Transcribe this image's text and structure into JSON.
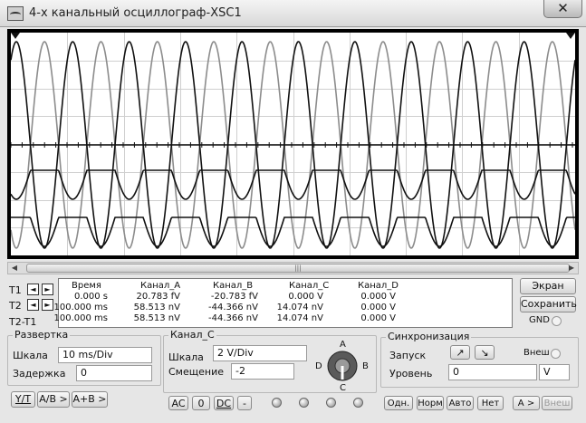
{
  "window": {
    "title": "4-х канальный осциллограф-XSC1",
    "close": "✕"
  },
  "colors": {
    "black_trace": "#111111",
    "gray_trace": "#8c8c8c"
  },
  "scroll": {
    "left_arrow": "◀",
    "right_arrow": "▶",
    "grip": "|||"
  },
  "readout": {
    "row_labels": [
      "T1",
      "T2",
      "T2-T1"
    ],
    "arrow_left": "◄",
    "arrow_right": "►",
    "columns": [
      "Время",
      "Канал_A",
      "Канал_B",
      "Канал_C",
      "Канал_D"
    ],
    "rows": [
      [
        "0.000 s",
        "20.783 fV",
        "-20.783 fV",
        "0.000 V",
        "0.000 V"
      ],
      [
        "100.000 ms",
        "58.513 nV",
        "-44.366 nV",
        "14.074 nV",
        "0.000 V"
      ],
      [
        "100.000 ms",
        "58.513 nV",
        "-44.366 nV",
        "14.074 nV",
        "0.000 V"
      ]
    ]
  },
  "side": {
    "screen_btn": "Экран",
    "save_btn": "Сохранить",
    "gnd": "GND"
  },
  "timebase": {
    "title": "Развертка",
    "scale_label": "Шкала",
    "scale_value": "10 ms/Div",
    "delay_label": "Задержка",
    "delay_value": "0",
    "yt": "Y/T",
    "ab": "A/B >",
    "apb": "A+B >"
  },
  "channel": {
    "title": "Канал_C",
    "scale_label": "Шкала",
    "scale_value": "2  V/Div",
    "offset_label": "Смещение",
    "offset_value": "-2",
    "ac": "AC",
    "zero": "0",
    "dc": "DC",
    "minus": "-",
    "knob": {
      "a": "A",
      "b": "B",
      "c": "C",
      "d": "D"
    }
  },
  "trigger": {
    "title": "Синхронизация",
    "start_label": "Запуск",
    "rise": "↗",
    "fall": "↘",
    "ext": "Внеш",
    "level_label": "Уровень",
    "level_value": "0",
    "level_unit": "V",
    "single": "Одн.",
    "normal": "Норм",
    "auto": "Авто",
    "none": "Нет",
    "a_btn": "A >",
    "ext_btn": "Внеш"
  }
}
